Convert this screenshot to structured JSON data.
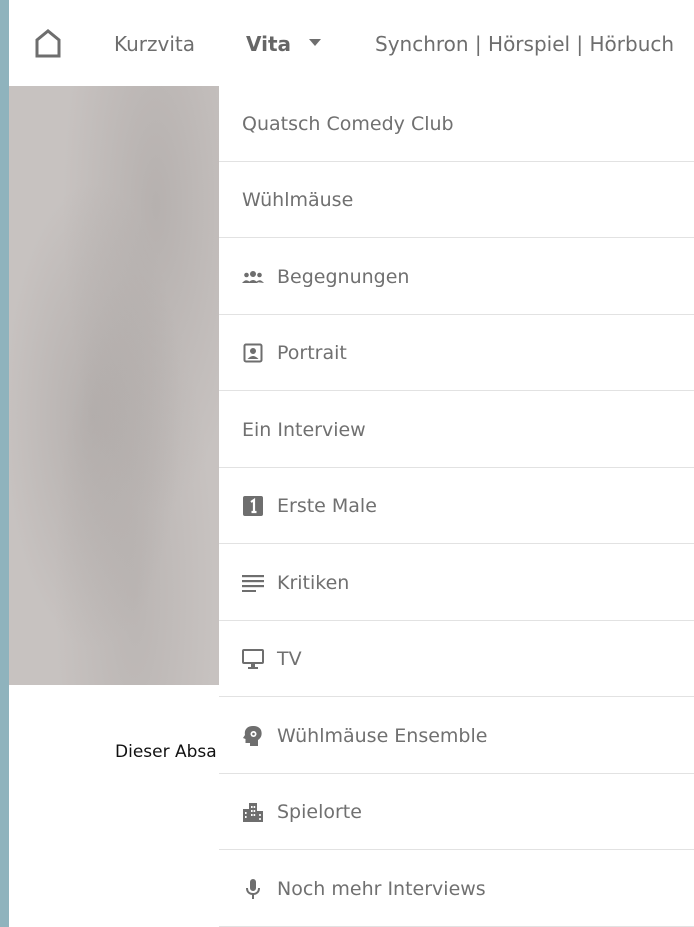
{
  "nav": {
    "home_icon": "home-icon",
    "links": {
      "kurzvita": "Kurzvita",
      "vita": "Vita",
      "synchron": "Synchron | Hörspiel | Hörbuch"
    },
    "vita_caret_icon": "caret-down-icon"
  },
  "content": {
    "paragraph_snippet": "Dieser Absa"
  },
  "dropdown": {
    "items": [
      {
        "label": "Quatsch Comedy Club",
        "icon": null
      },
      {
        "label": "Wühlmäuse",
        "icon": null
      },
      {
        "label": "Begegnungen",
        "icon": "people-icon"
      },
      {
        "label": "Portrait",
        "icon": "portrait-icon"
      },
      {
        "label": "Ein Interview",
        "icon": null
      },
      {
        "label": "Erste Male",
        "icon": "number-one-icon"
      },
      {
        "label": "Kritiken",
        "icon": "lines-icon"
      },
      {
        "label": "TV",
        "icon": "monitor-icon"
      },
      {
        "label": "Wühlmäuse Ensemble",
        "icon": "head-gear-icon"
      },
      {
        "label": "Spielorte",
        "icon": "city-icon"
      },
      {
        "label": "Noch mehr Interviews",
        "icon": "microphone-icon"
      }
    ]
  },
  "colors": {
    "left_strip": "#8fb3bd",
    "image_placeholder": "#c7c2c0",
    "text": "#707070",
    "divider": "#e2e2e2"
  }
}
